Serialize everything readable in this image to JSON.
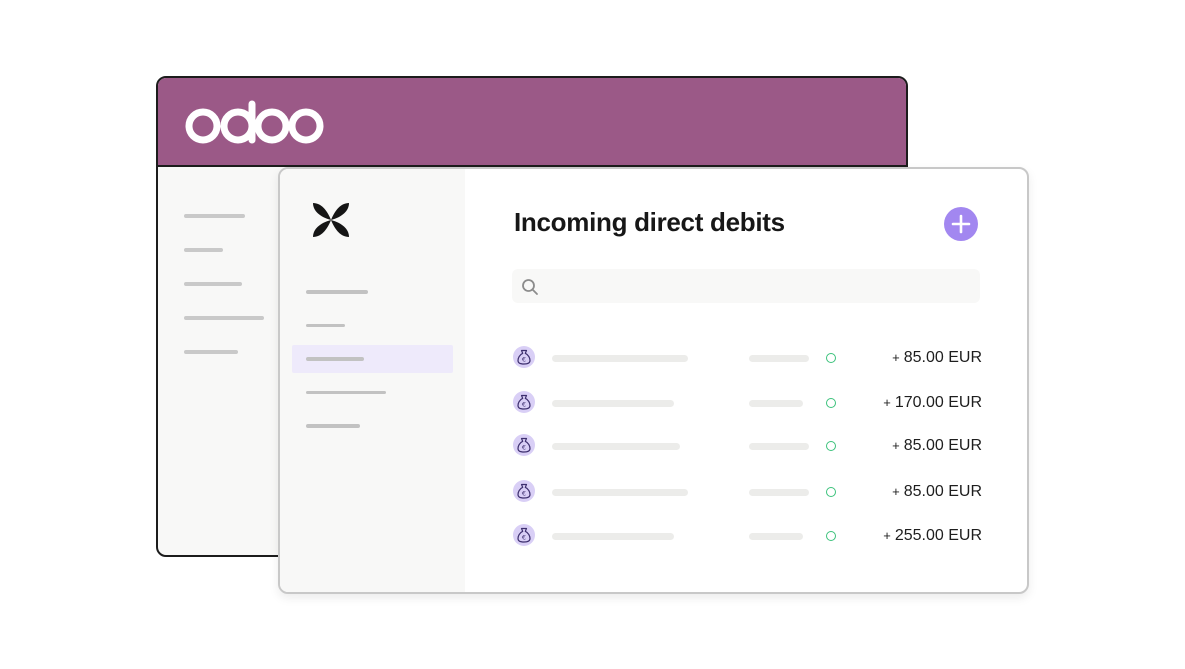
{
  "colors": {
    "odoo_header": "#9b5987",
    "accent": "#a287f0",
    "status_ok": "#3cc27c",
    "sidebar_active": "#eeeafb"
  },
  "back_app": {
    "logo_text": "odoo",
    "logo_icon": "odoo-logo"
  },
  "front_app": {
    "brand_icon": "four-petal-logo",
    "page_title": "Incoming direct debits",
    "add_button_icon": "plus-icon",
    "search": {
      "icon": "search-icon",
      "placeholder": "",
      "value": ""
    },
    "transactions": [
      {
        "icon": "money-bag-euro-icon",
        "sign": "+",
        "amount": "85.00 EUR",
        "status": "ok"
      },
      {
        "icon": "money-bag-euro-icon",
        "sign": "+",
        "amount": "170.00 EUR",
        "status": "ok"
      },
      {
        "icon": "money-bag-euro-icon",
        "sign": "+",
        "amount": "85.00 EUR",
        "status": "ok"
      },
      {
        "icon": "money-bag-euro-icon",
        "sign": "+",
        "amount": "85.00 EUR",
        "status": "ok"
      },
      {
        "icon": "money-bag-euro-icon",
        "sign": "+",
        "amount": "255.00 EUR",
        "status": "ok"
      }
    ]
  }
}
